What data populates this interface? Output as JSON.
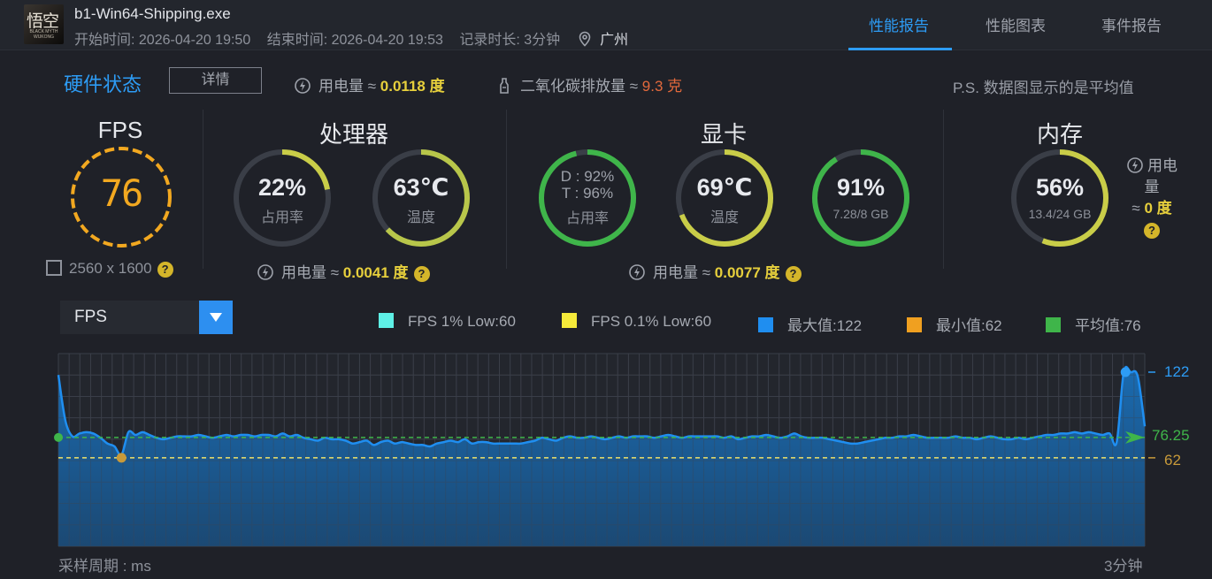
{
  "header": {
    "exe_name": "b1-Win64-Shipping.exe",
    "icon_name": "black-myth-wukong-icon",
    "icon_glyph": "悟空",
    "icon_caption": "BLACK MYTH WUKONG",
    "start_time": "开始时间: 2026-04-20 19:50",
    "end_time": "结束时间: 2026-04-20 19:53",
    "duration": "记录时长: 3分钟",
    "location": "广州",
    "tabs": [
      {
        "label": "性能报告",
        "active": true
      },
      {
        "label": "性能图表",
        "active": false
      },
      {
        "label": "事件报告",
        "active": false
      }
    ]
  },
  "hardware": {
    "title": "硬件状态",
    "detail_button": "详情",
    "power_label": "用电量 ≈",
    "power_value": "0.0118 度",
    "co2_label": "二氧化碳排放量 ≈",
    "co2_value": "9.3 克",
    "note": "P.S. 数据图显示的是平均值"
  },
  "fps": {
    "title": "FPS",
    "value": "76",
    "resolution": "2560 x 1600"
  },
  "cpu": {
    "title": "处理器",
    "usage": {
      "value": "22%",
      "label": "占用率",
      "percent": 22
    },
    "temp": {
      "value": "63℃",
      "label": "温度",
      "percent": 63
    },
    "power_label": "用电量 ≈",
    "power_value": "0.0041 度"
  },
  "gpu": {
    "title": "显卡",
    "usage": {
      "line1": "D : 92%",
      "line2": "T : 96%",
      "label": "占用率",
      "percent": 96
    },
    "temp": {
      "value": "69℃",
      "label": "温度",
      "percent": 69
    },
    "vram": {
      "value": "91%",
      "label": "7.28/8 GB",
      "percent": 91
    },
    "power_label": "用电量 ≈",
    "power_value": "0.0077 度"
  },
  "memory": {
    "title": "内存",
    "usage": {
      "value": "56%",
      "label": "13.4/24 GB",
      "percent": 56
    },
    "power_label": "用电量",
    "power_prefix": "≈",
    "power_value": "0 度"
  },
  "chart_controls": {
    "selected_metric": "FPS",
    "legend": [
      {
        "label": "FPS 1% Low:60",
        "color": "#5ef0e6"
      },
      {
        "label": "FPS 0.1% Low:60",
        "color": "#f5ea3a"
      },
      {
        "label": "最大值:122",
        "color": "#1f8ef0"
      },
      {
        "label": "最小值:62",
        "color": "#f0a020"
      },
      {
        "label": "平均值:76",
        "color": "#3fb54a"
      }
    ],
    "sample_label": "采样周期 : ms",
    "end_label": "3分钟"
  },
  "chart_data": {
    "type": "area",
    "series": [
      {
        "values": [
          120,
          88,
          77,
          79,
          80,
          79,
          76,
          72,
          70,
          64,
          80,
          78,
          80,
          78,
          76,
          75,
          76,
          77,
          77,
          77,
          78,
          77,
          76,
          77,
          78,
          77,
          78,
          78,
          77,
          78,
          78,
          77,
          79,
          77,
          78,
          76,
          75,
          74,
          76,
          75,
          75,
          74,
          72,
          73,
          74,
          71,
          73,
          74,
          72,
          73,
          72,
          71,
          71,
          70,
          72,
          73,
          74,
          73,
          75,
          72,
          73,
          73,
          72,
          72,
          72,
          72,
          72,
          73,
          74,
          76,
          75,
          74,
          76,
          77,
          76,
          76,
          77,
          76,
          75,
          76,
          77,
          76,
          77,
          77,
          77,
          76,
          77,
          78,
          77,
          76,
          77,
          77,
          77,
          77,
          77,
          76,
          77,
          75,
          76,
          77,
          77,
          78,
          77,
          76,
          77,
          79,
          77,
          76,
          76,
          76,
          75,
          74,
          73,
          72,
          72,
          73,
          74,
          75,
          76,
          76,
          77,
          77,
          78,
          77,
          76,
          76,
          76,
          76,
          77,
          76,
          76,
          75,
          76,
          77,
          76,
          75,
          75,
          76,
          75,
          76,
          77,
          78,
          78,
          79,
          79,
          80,
          79,
          80,
          79,
          78,
          79,
          73,
          122,
          122,
          119,
          84
        ]
      }
    ],
    "reference_lines": {
      "max": 122,
      "avg": 76.25,
      "min": 62
    },
    "right_labels": [
      "122",
      "76.25",
      "62"
    ],
    "ylim": [
      0,
      135
    ],
    "grid": true,
    "xlabel": "采样周期 : ms",
    "x_end_label": "3分钟"
  },
  "colors": {
    "accent": "#2d9cf5",
    "series": "#1f8ef0",
    "fps_ring": "#f2a820",
    "value_yellow": "#e6cf3c",
    "co2": "#e3693c",
    "avg": "#3fb54a",
    "min": "#c89a3a"
  }
}
